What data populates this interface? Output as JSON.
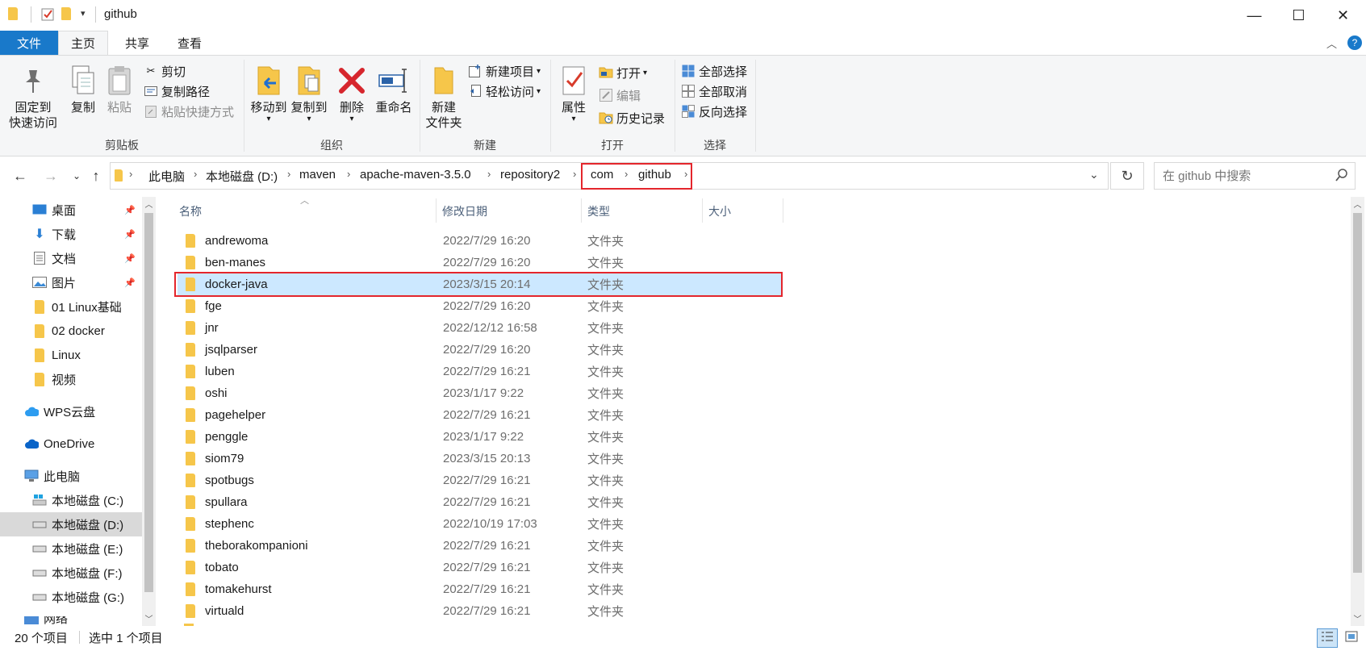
{
  "window": {
    "title": "github",
    "minimize": "—",
    "maximize": "☐",
    "close": "✕"
  },
  "tabs": {
    "file": "文件",
    "home": "主页",
    "share": "共享",
    "view": "查看"
  },
  "ribbon": {
    "clipboard": {
      "label": "剪贴板",
      "pin_line1": "固定到",
      "pin_line2": "快速访问",
      "copy": "复制",
      "paste": "粘贴",
      "cut": "剪切",
      "copy_path": "复制路径",
      "paste_shortcut": "粘贴快捷方式"
    },
    "organize": {
      "label": "组织",
      "move_to": "移动到",
      "copy_to": "复制到",
      "delete": "删除",
      "rename": "重命名"
    },
    "new": {
      "label": "新建",
      "new_folder_line1": "新建",
      "new_folder_line2": "文件夹",
      "new_item": "新建项目",
      "easy_access": "轻松访问"
    },
    "open": {
      "label": "打开",
      "properties": "属性",
      "open": "打开",
      "edit": "编辑",
      "history": "历史记录"
    },
    "select": {
      "label": "选择",
      "select_all": "全部选择",
      "select_none": "全部取消",
      "invert": "反向选择"
    }
  },
  "address": {
    "crumbs": [
      "此电脑",
      "本地磁盘 (D:)",
      "maven",
      "apache-maven-3.5.0",
      "repository2",
      "com",
      "github"
    ],
    "search_placeholder": "在 github 中搜索"
  },
  "nav": {
    "items": [
      {
        "label": "桌面",
        "pinned": true
      },
      {
        "label": "下载",
        "pinned": true
      },
      {
        "label": "文档",
        "pinned": true
      },
      {
        "label": "图片",
        "pinned": true
      },
      {
        "label": "01 Linux基础"
      },
      {
        "label": "02 docker"
      },
      {
        "label": "Linux"
      },
      {
        "label": "视频"
      },
      {
        "label": "WPS云盘"
      },
      {
        "label": "OneDrive"
      },
      {
        "label": "此电脑"
      },
      {
        "label": "本地磁盘 (C:)"
      },
      {
        "label": "本地磁盘 (D:)"
      },
      {
        "label": "本地磁盘 (E:)"
      },
      {
        "label": "本地磁盘 (F:)"
      },
      {
        "label": "本地磁盘 (G:)"
      },
      {
        "label": "网络"
      }
    ],
    "pin_glyph": "📌"
  },
  "columns": {
    "name": "名称",
    "date": "修改日期",
    "type": "类型",
    "size": "大小"
  },
  "files": [
    {
      "name": "andrewoma",
      "date": "2022/7/29 16:20",
      "type": "文件夹"
    },
    {
      "name": "ben-manes",
      "date": "2022/7/29 16:20",
      "type": "文件夹"
    },
    {
      "name": "docker-java",
      "date": "2023/3/15 20:14",
      "type": "文件夹"
    },
    {
      "name": "fge",
      "date": "2022/7/29 16:20",
      "type": "文件夹"
    },
    {
      "name": "jnr",
      "date": "2022/12/12 16:58",
      "type": "文件夹"
    },
    {
      "name": "jsqlparser",
      "date": "2022/7/29 16:20",
      "type": "文件夹"
    },
    {
      "name": "luben",
      "date": "2022/7/29 16:21",
      "type": "文件夹"
    },
    {
      "name": "oshi",
      "date": "2023/1/17 9:22",
      "type": "文件夹"
    },
    {
      "name": "pagehelper",
      "date": "2022/7/29 16:21",
      "type": "文件夹"
    },
    {
      "name": "penggle",
      "date": "2023/1/17 9:22",
      "type": "文件夹"
    },
    {
      "name": "siom79",
      "date": "2023/3/15 20:13",
      "type": "文件夹"
    },
    {
      "name": "spotbugs",
      "date": "2022/7/29 16:21",
      "type": "文件夹"
    },
    {
      "name": "spullara",
      "date": "2022/7/29 16:21",
      "type": "文件夹"
    },
    {
      "name": "stephenc",
      "date": "2022/10/19 17:03",
      "type": "文件夹"
    },
    {
      "name": "theborakompanioni",
      "date": "2022/7/29 16:21",
      "type": "文件夹"
    },
    {
      "name": "tobato",
      "date": "2022/7/29 16:21",
      "type": "文件夹"
    },
    {
      "name": "tomakehurst",
      "date": "2022/7/29 16:21",
      "type": "文件夹"
    },
    {
      "name": "virtuald",
      "date": "2022/7/29 16:21",
      "type": "文件夹"
    }
  ],
  "status": {
    "count": "20 个项目",
    "selected": "选中 1 个项目"
  },
  "colors": {
    "accent": "#1979ca",
    "highlight": "#e4262c",
    "selection": "#cce8ff",
    "folder": "#f6c64a"
  }
}
